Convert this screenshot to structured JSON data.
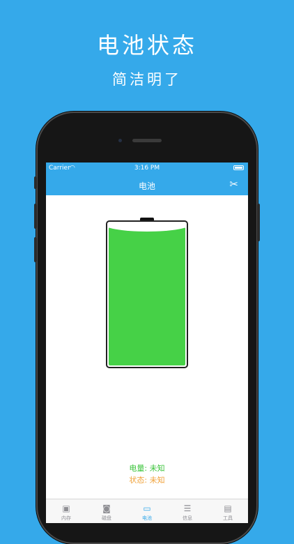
{
  "promo": {
    "title": "电池状态",
    "subtitle": "简洁明了"
  },
  "status_bar": {
    "carrier": "Carrier",
    "time": "3:16 PM"
  },
  "nav": {
    "title": "电池"
  },
  "battery": {
    "level_fraction": 0.97,
    "fill_color": "#46d147",
    "level_text": "电量: 未知",
    "state_text": "状态: 未知"
  },
  "tabs": [
    {
      "label": "内存",
      "icon": "memory-chip-icon",
      "glyph": "▣",
      "active": false
    },
    {
      "label": "磁盘",
      "icon": "disk-icon",
      "glyph": "◙",
      "active": false
    },
    {
      "label": "电池",
      "icon": "battery-tab-icon",
      "glyph": "▭",
      "active": true
    },
    {
      "label": "信息",
      "icon": "info-list-icon",
      "glyph": "☰",
      "active": false
    },
    {
      "label": "工具",
      "icon": "toolbox-icon",
      "glyph": "▤",
      "active": false
    }
  ],
  "colors": {
    "brand": "#35a9ea",
    "level_text": "#3cc43c",
    "state_text": "#f0a23a"
  }
}
